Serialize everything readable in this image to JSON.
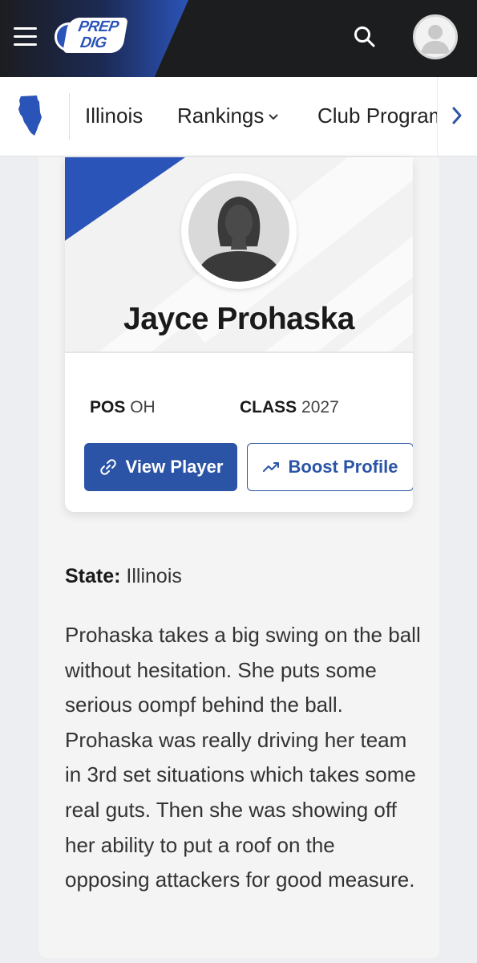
{
  "header": {
    "logo_line1": "PREP",
    "logo_line2": "DIG",
    "menu_icon": "hamburger-menu-icon",
    "search_icon": "search-icon",
    "avatar_icon": "user-avatar-icon"
  },
  "subnav": {
    "state_icon": "illinois-map-icon",
    "items": [
      {
        "label": "Illinois"
      },
      {
        "label": "Rankings"
      },
      {
        "label": "Club Programs"
      }
    ],
    "next_icon": "chevron-right-icon"
  },
  "player": {
    "name": "Jayce Prohaska",
    "pos_label": "POS",
    "pos_value": "OH",
    "class_label": "CLASS",
    "class_value": "2027",
    "view_button": "View Player",
    "boost_button": "Boost Profile"
  },
  "details": {
    "state_label": "State:",
    "state_value": "Illinois",
    "bio": "Prohaska takes a big swing on the ball without hesitation. She puts some serious oompf behind the ball. Prohaska was really driving her team in 3rd set situations which takes some real guts. Then she was showing off her ability to put a roof on the opposing attackers for good measure."
  },
  "colors": {
    "header_bg": "#1c1d1f",
    "brand_blue": "#2b54b8",
    "button_blue": "#2b54a6"
  }
}
